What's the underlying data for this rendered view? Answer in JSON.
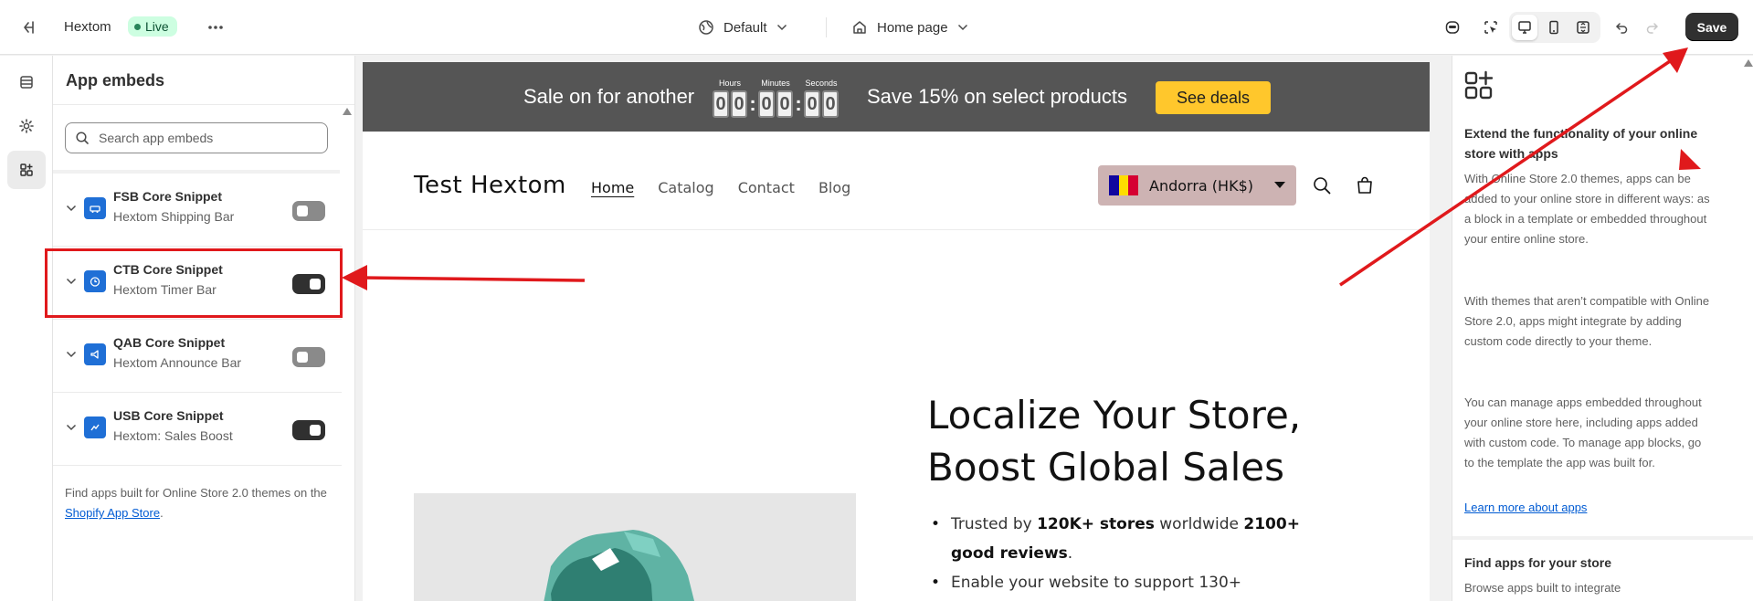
{
  "topbar": {
    "store_name": "Hextom",
    "live_label": "Live",
    "theme_label": "Default",
    "page_label": "Home page",
    "save_label": "Save"
  },
  "panel": {
    "title": "App embeds",
    "search_placeholder": "Search app embeds",
    "items": [
      {
        "name": "FSB Core Snippet",
        "app": "Hextom Shipping Bar",
        "enabled": false
      },
      {
        "name": "CTB Core Snippet",
        "app": "Hextom Timer Bar",
        "enabled": true
      },
      {
        "name": "QAB Core Snippet",
        "app": "Hextom Announce Bar",
        "enabled": false
      },
      {
        "name": "USB Core Snippet",
        "app": "Hextom: Sales Boost",
        "enabled": true
      }
    ],
    "footer_text": "Find apps built for Online Store 2.0 themes on the",
    "footer_link": "Shopify App Store",
    "footer_end": "."
  },
  "preview": {
    "promo": {
      "lead": "Sale on for another",
      "timer_labels": {
        "hours": "Hours",
        "minutes": "Minutes",
        "seconds": "Seconds"
      },
      "digits": {
        "h1": "0",
        "h2": "0",
        "m1": "0",
        "m2": "0",
        "s1": "0",
        "s2": "0"
      },
      "colon": ":",
      "tail": "Save 15% on select products",
      "cta": "See deals"
    },
    "store_name": "Test Hextom",
    "nav": [
      "Home",
      "Catalog",
      "Contact",
      "Blog"
    ],
    "country": "Andorra (HK$)",
    "hero_title_1": "Localize Your Store,",
    "hero_title_2": "Boost Global Sales",
    "bullet1": {
      "a": "Trusted by ",
      "b": "120K+ stores",
      "c": " worldwide ",
      "d": "2100+ good reviews",
      "e": "."
    },
    "bullet2": "Enable your website to support 130+"
  },
  "rightpanel": {
    "title": "Extend the functionality of your online store with apps",
    "p1": "With Online Store 2.0 themes, apps can be added to your online store in different ways: as a block in a template or embedded throughout your entire online store.",
    "p2": "With themes that aren’t compatible with Online Store 2.0, apps might integrate by adding custom code directly to your theme.",
    "p3": "You can manage apps embedded throughout your online store here, including apps added with custom code. To manage app blocks, go to the template the app was built for.",
    "link": "Learn more about apps",
    "h2": "Find apps for your store",
    "p4": "Browse apps built to integrate"
  },
  "colors": {
    "accent_red": "#e0191c",
    "promo_bg": "#555555",
    "cta_yellow": "#ffc72c",
    "country_bg": "#cdb3b3",
    "link_blue": "#005bd3"
  }
}
